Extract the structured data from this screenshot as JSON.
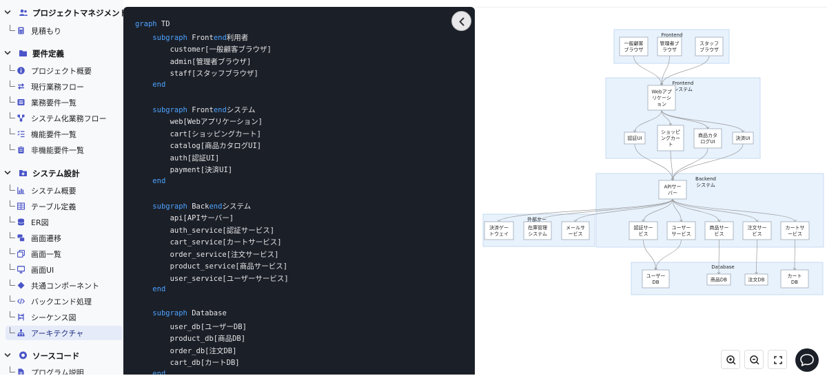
{
  "sidebar": {
    "sections": [
      {
        "label": "プロジェクトマネジメント",
        "icon": "users-icon",
        "items": [
          {
            "label": "見積もり",
            "icon": "calculator-icon"
          }
        ]
      },
      {
        "label": "要件定義",
        "icon": "folder-icon",
        "items": [
          {
            "label": "プロジェクト概要",
            "icon": "info-icon"
          },
          {
            "label": "現行業務フロー",
            "icon": "swap-icon"
          },
          {
            "label": "業務要件一覧",
            "icon": "list-icon"
          },
          {
            "label": "システム化業務フロー",
            "icon": "flow-icon"
          },
          {
            "label": "機能要件一覧",
            "icon": "checklist-icon"
          },
          {
            "label": "非機能要件一覧",
            "icon": "clipboard-icon"
          }
        ]
      },
      {
        "label": "システム設計",
        "icon": "folder-plus-icon",
        "items": [
          {
            "label": "システム概要",
            "icon": "bar-chart-icon"
          },
          {
            "label": "テーブル定義",
            "icon": "table-icon"
          },
          {
            "label": "ER図",
            "icon": "database-icon"
          },
          {
            "label": "画面遷移",
            "icon": "screens-icon"
          },
          {
            "label": "画面一覧",
            "icon": "copy-icon"
          },
          {
            "label": "画面UI",
            "icon": "monitor-icon"
          },
          {
            "label": "共通コンポーネント",
            "icon": "diamond-icon"
          },
          {
            "label": "バックエンド処理",
            "icon": "code-icon"
          },
          {
            "label": "シーケンス図",
            "icon": "sequence-icon"
          },
          {
            "label": "アーキテクチャ",
            "icon": "sitemap-icon",
            "active": true
          }
        ]
      },
      {
        "label": "ソースコード",
        "icon": "github-icon",
        "items": [
          {
            "label": "プログラム説明",
            "icon": "file-icon"
          }
        ]
      }
    ]
  },
  "code": {
    "lines": [
      [
        {
          "t": "graph",
          "k": 1
        },
        {
          "t": " TD"
        }
      ],
      [
        {
          "t": "    "
        },
        {
          "t": "subgraph",
          "k": 1
        },
        {
          "t": " Front"
        },
        {
          "t": "end",
          "k": 1
        },
        {
          "t": "利用者"
        }
      ],
      [
        {
          "t": "        customer[一般顧客ブラウザ]"
        }
      ],
      [
        {
          "t": "        admin[管理者ブラウザ]"
        }
      ],
      [
        {
          "t": "        staff[スタッフブラウザ]"
        }
      ],
      [
        {
          "t": "    "
        },
        {
          "t": "end",
          "k": 1
        }
      ],
      [
        {
          "t": ""
        }
      ],
      [
        {
          "t": "    "
        },
        {
          "t": "subgraph",
          "k": 1
        },
        {
          "t": " Front"
        },
        {
          "t": "end",
          "k": 1
        },
        {
          "t": "システム"
        }
      ],
      [
        {
          "t": "        web[Webアプリケーション]"
        }
      ],
      [
        {
          "t": "        cart[ショッピングカート]"
        }
      ],
      [
        {
          "t": "        catalog[商品カタログUI]"
        }
      ],
      [
        {
          "t": "        auth[認証UI]"
        }
      ],
      [
        {
          "t": "        payment[決済UI]"
        }
      ],
      [
        {
          "t": "    "
        },
        {
          "t": "end",
          "k": 1
        }
      ],
      [
        {
          "t": ""
        }
      ],
      [
        {
          "t": "    "
        },
        {
          "t": "subgraph",
          "k": 1
        },
        {
          "t": " Back"
        },
        {
          "t": "end",
          "k": 1
        },
        {
          "t": "システム"
        }
      ],
      [
        {
          "t": "        api[APIサーバー]"
        }
      ],
      [
        {
          "t": "        auth_service[認証サービス]"
        }
      ],
      [
        {
          "t": "        cart_service[カートサービス]"
        }
      ],
      [
        {
          "t": "        order_service[注文サービス]"
        }
      ],
      [
        {
          "t": "        product_service[商品サービス]"
        }
      ],
      [
        {
          "t": "        user_service[ユーザーサービス]"
        }
      ],
      [
        {
          "t": "    "
        },
        {
          "t": "end",
          "k": 1
        }
      ],
      [
        {
          "t": ""
        }
      ],
      [
        {
          "t": "    "
        },
        {
          "t": "subgraph",
          "k": 1
        },
        {
          "t": " Database"
        }
      ],
      [
        {
          "t": "        user_db[ユーザーDB]"
        }
      ],
      [
        {
          "t": "        product_db[商品DB]"
        }
      ],
      [
        {
          "t": "        order_db[注文DB]"
        }
      ],
      [
        {
          "t": "        cart_db[カートDB]"
        }
      ],
      [
        {
          "t": "    "
        },
        {
          "t": "end",
          "k": 1
        }
      ]
    ]
  },
  "diagram": {
    "groups": [
      {
        "id": "g-frontend-users",
        "label": "Frontend"
      },
      {
        "id": "g-frontend-system",
        "label": "Frontend\nシステム"
      },
      {
        "id": "g-backend",
        "label": "Backend\nシステム"
      },
      {
        "id": "g-external",
        "label": "外部サー"
      },
      {
        "id": "g-database",
        "label": "Database"
      }
    ],
    "nodes": [
      {
        "id": "customer",
        "label": "一般顧客\nブラウザ"
      },
      {
        "id": "admin",
        "label": "管理者ブ\nラウザ"
      },
      {
        "id": "staff",
        "label": "スタッフ\nブラウザ"
      },
      {
        "id": "web",
        "label": "Webアプ\nリケーシ\nョン"
      },
      {
        "id": "auth",
        "label": "認証UI"
      },
      {
        "id": "cart",
        "label": "ショッピ\nングカー\nト"
      },
      {
        "id": "catalog",
        "label": "商品カタ\nログUI"
      },
      {
        "id": "payment",
        "label": "決済UI"
      },
      {
        "id": "api",
        "label": "APIサー\nバー"
      },
      {
        "id": "payment_gw",
        "label": "決済ゲー\nトウェイ"
      },
      {
        "id": "inventory",
        "label": "在庫管理\nシステム"
      },
      {
        "id": "mail",
        "label": "メールサ\nービス"
      },
      {
        "id": "auth_service",
        "label": "認証サー\nビス"
      },
      {
        "id": "user_service",
        "label": "ユーザー\nサービス"
      },
      {
        "id": "product_service",
        "label": "商品サー\nビス"
      },
      {
        "id": "order_service",
        "label": "注文サー\nビス"
      },
      {
        "id": "cart_service",
        "label": "カートサ\nービス"
      },
      {
        "id": "user_db",
        "label": "ユーザー\nDB"
      },
      {
        "id": "product_db",
        "label": "商品DB"
      },
      {
        "id": "order_db",
        "label": "注文DB"
      },
      {
        "id": "cart_db",
        "label": "カート\nDB"
      }
    ],
    "edges": [
      [
        "customer",
        "web"
      ],
      [
        "admin",
        "web"
      ],
      [
        "staff",
        "web"
      ],
      [
        "web",
        "auth"
      ],
      [
        "web",
        "cart"
      ],
      [
        "web",
        "catalog"
      ],
      [
        "web",
        "payment"
      ],
      [
        "auth",
        "api"
      ],
      [
        "cart",
        "api"
      ],
      [
        "catalog",
        "api"
      ],
      [
        "payment",
        "api"
      ],
      [
        "api",
        "auth_service"
      ],
      [
        "api",
        "user_service"
      ],
      [
        "api",
        "product_service"
      ],
      [
        "api",
        "order_service"
      ],
      [
        "api",
        "cart_service"
      ],
      [
        "api",
        "payment_gw"
      ],
      [
        "api",
        "inventory"
      ],
      [
        "api",
        "mail"
      ],
      [
        "auth_service",
        "user_db"
      ],
      [
        "user_service",
        "user_db"
      ],
      [
        "product_service",
        "product_db"
      ],
      [
        "order_service",
        "order_db"
      ],
      [
        "cart_service",
        "cart_db"
      ]
    ]
  },
  "controls": [
    {
      "name": "zoom-in-button",
      "icon": "zoom-in-icon"
    },
    {
      "name": "zoom-out-button",
      "icon": "zoom-out-icon"
    },
    {
      "name": "fullscreen-button",
      "icon": "fullscreen-icon"
    }
  ],
  "colors": {
    "sidebar_bg": "#f8f9fb",
    "active_bg": "#e6ebf9",
    "code_bg": "#1b1f28",
    "keyword": "#4da3ff",
    "group_fill": "#e8f2fd",
    "group_stroke": "#b9d3ee",
    "edge": "#999999"
  }
}
